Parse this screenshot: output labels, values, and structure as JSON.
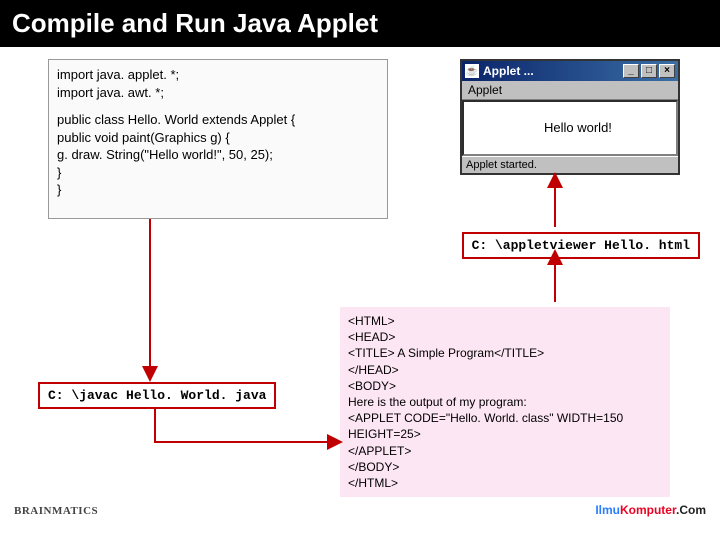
{
  "title": "Compile and Run Java Applet",
  "code": {
    "l1": "import java. applet. *;",
    "l2": "import java. awt. *;",
    "l3": "public class Hello. World extends Applet {",
    "l4": "   public void paint(Graphics g) {",
    "l5": "      g. draw. String(\"Hello world!\", 50, 25);",
    "l6": "   }",
    "l7": "}"
  },
  "applet": {
    "title": "Applet ...",
    "menu": "Applet",
    "canvas_text": "Hello world!",
    "status": "Applet started."
  },
  "commands": {
    "javac": "C: \\javac Hello. World. java",
    "appletviewer": "C: \\appletviewer Hello. html"
  },
  "html_src": {
    "l1": "<HTML>",
    "l2": "<HEAD>",
    "l3": "<TITLE> A Simple Program</TITLE>",
    "l4": "</HEAD>",
    "l5": "<BODY>",
    "l6": "Here is the output of my program:",
    "l7": "<APPLET CODE=\"Hello. World. class\" WIDTH=150 HEIGHT=25>",
    "l8": "</APPLET>",
    "l9": "</BODY>",
    "l10": "</HTML>"
  },
  "footer": {
    "left_brand": "BRAINMATICS",
    "right_a": "Ilmu",
    "right_b": "Komputer",
    "right_c": ".Com"
  }
}
